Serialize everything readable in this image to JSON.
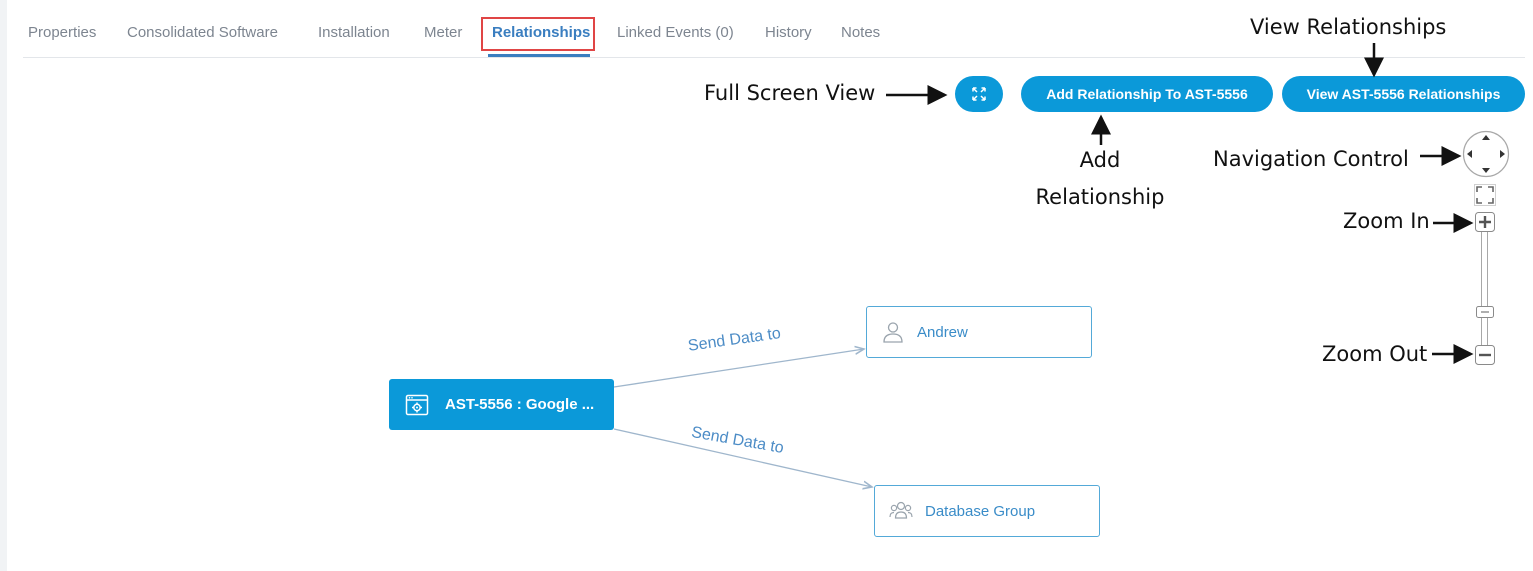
{
  "tabs": [
    {
      "label": "Properties",
      "active": false
    },
    {
      "label": "Consolidated Software",
      "active": false
    },
    {
      "label": "Installation",
      "active": false
    },
    {
      "label": "Meter",
      "active": false
    },
    {
      "label": "Relationships",
      "active": true
    },
    {
      "label": "Linked Events (0)",
      "active": false
    },
    {
      "label": "History",
      "active": false
    },
    {
      "label": "Notes",
      "active": false
    }
  ],
  "toolbar": {
    "add_relationship_label": "Add Relationship To AST-5556",
    "view_relationships_label": "View AST-5556 Relationships",
    "fullscreen_icon": "expand-arrows-icon"
  },
  "annotations": {
    "full_screen_view": "Full Screen View",
    "view_relationships": "View Relationships",
    "add_relationship_line1": "Add",
    "add_relationship_line2": "Relationship",
    "navigation_control": "Navigation Control",
    "zoom_in": "Zoom In",
    "zoom_out": "Zoom Out"
  },
  "graph": {
    "main_node": {
      "label": "AST-5556 : Google ...",
      "icon": "software-window-gear-icon"
    },
    "nodes": [
      {
        "label": "Andrew",
        "icon": "user-icon"
      },
      {
        "label": "Database Group",
        "icon": "user-group-icon"
      }
    ],
    "edges": [
      {
        "label": "Send Data to"
      },
      {
        "label": "Send Data to"
      }
    ]
  },
  "colors": {
    "accent": "#0b99d9",
    "active_tab": "#3a7ec0",
    "highlight": "#e04545",
    "edge": "#9fb6cc"
  }
}
